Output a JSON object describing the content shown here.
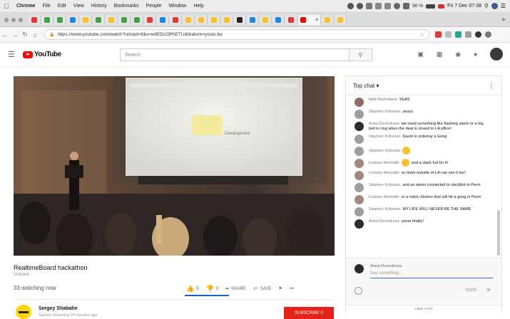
{
  "menubar": {
    "app": "Chrome",
    "items": [
      "File",
      "Edit",
      "View",
      "History",
      "Bookmarks",
      "People",
      "Window",
      "Help"
    ],
    "battery": "90 %",
    "clock": "Fri 7 Dec 07:38"
  },
  "browser": {
    "tab_favicon_colors": [
      "#e53935",
      "#43a047",
      "#43a047",
      "#1e88e5",
      "#fbc02d",
      "#43a047",
      "#fbc02d",
      "#43a047",
      "#43a047",
      "#e53935",
      "#1e88e5",
      "#e53935",
      "#fbc02d",
      "#fbc02d",
      "#fbc02d",
      "#fbc02d",
      "#222222",
      "#1e88e5",
      "#fbc02d",
      "#1e88e5",
      "#e53935",
      "#fbc02d",
      "#fbc02d"
    ],
    "active_tab_label": "x",
    "url": "https://www.youtube.com/watch?reload=9&v=w9EDcOPhETU&feature=youtu.be"
  },
  "youtube": {
    "logo_text": "YouTube",
    "search_placeholder": "Search"
  },
  "video": {
    "title": "RealtimeBoard hackathon",
    "subtitle": "Unlisted",
    "watching": "33 watching now",
    "likes": "5",
    "dislikes": "0",
    "like_ratio": 1.0,
    "share": "SHARE",
    "save": "SAVE",
    "more": "•••",
    "screen_text": "Development"
  },
  "channel": {
    "name": "Sergey Shabalin",
    "status": "Started streaming 24 minutes ago",
    "subscribe": "SUBSCRIBE 0"
  },
  "chat": {
    "header": "Top chat",
    "messages": [
      {
        "author": "Matt Mulholland",
        "text": "YEAS",
        "color": "#8d6e63"
      },
      {
        "author": "Stephen Krikorian",
        "text": "yesss",
        "color": "#9e9e9e"
      },
      {
        "author": "Anna Dvornikova",
        "text": "we need something like flashing alarm or a big bell to ring when the deal is closed in LA office!",
        "color": "#2b2b2b"
      },
      {
        "author": "Stephen Krikorian",
        "text": "David is ordering a Gong",
        "color": "#9e9e9e"
      },
      {
        "author": "Stephen Krikorian",
        "text": "",
        "emoji": "😂",
        "color": "#9e9e9e"
      },
      {
        "author": "Lindsey Meredith",
        "text": "and a slack bot for it!",
        "emoji_before": "😂",
        "color": "#a1887f"
      },
      {
        "author": "Lindsey Meredith",
        "text": "so team outside of LA can see it too!",
        "color": "#a1887f"
      },
      {
        "author": "Stephen Krikorian",
        "text": "and an alarm connected to slackbot in Perm",
        "color": "#9e9e9e"
      },
      {
        "author": "Lindsey Meredith",
        "text": "or a robot chicken that will hit a gong in Perm",
        "color": "#a1887f"
      },
      {
        "author": "Stephen Krikorian",
        "text": "MY LIFE WILL NEVER BE THE SAME",
        "color": "#9e9e9e"
      },
      {
        "author": "Anna Dvornikova",
        "text": "yeeer finally!",
        "color": "#2b2b2b"
      }
    ],
    "compose_name": "Anna Dvornikova",
    "compose_placeholder": "Say something...",
    "char_count": "0/200",
    "hide": "HIDE CHAT"
  }
}
